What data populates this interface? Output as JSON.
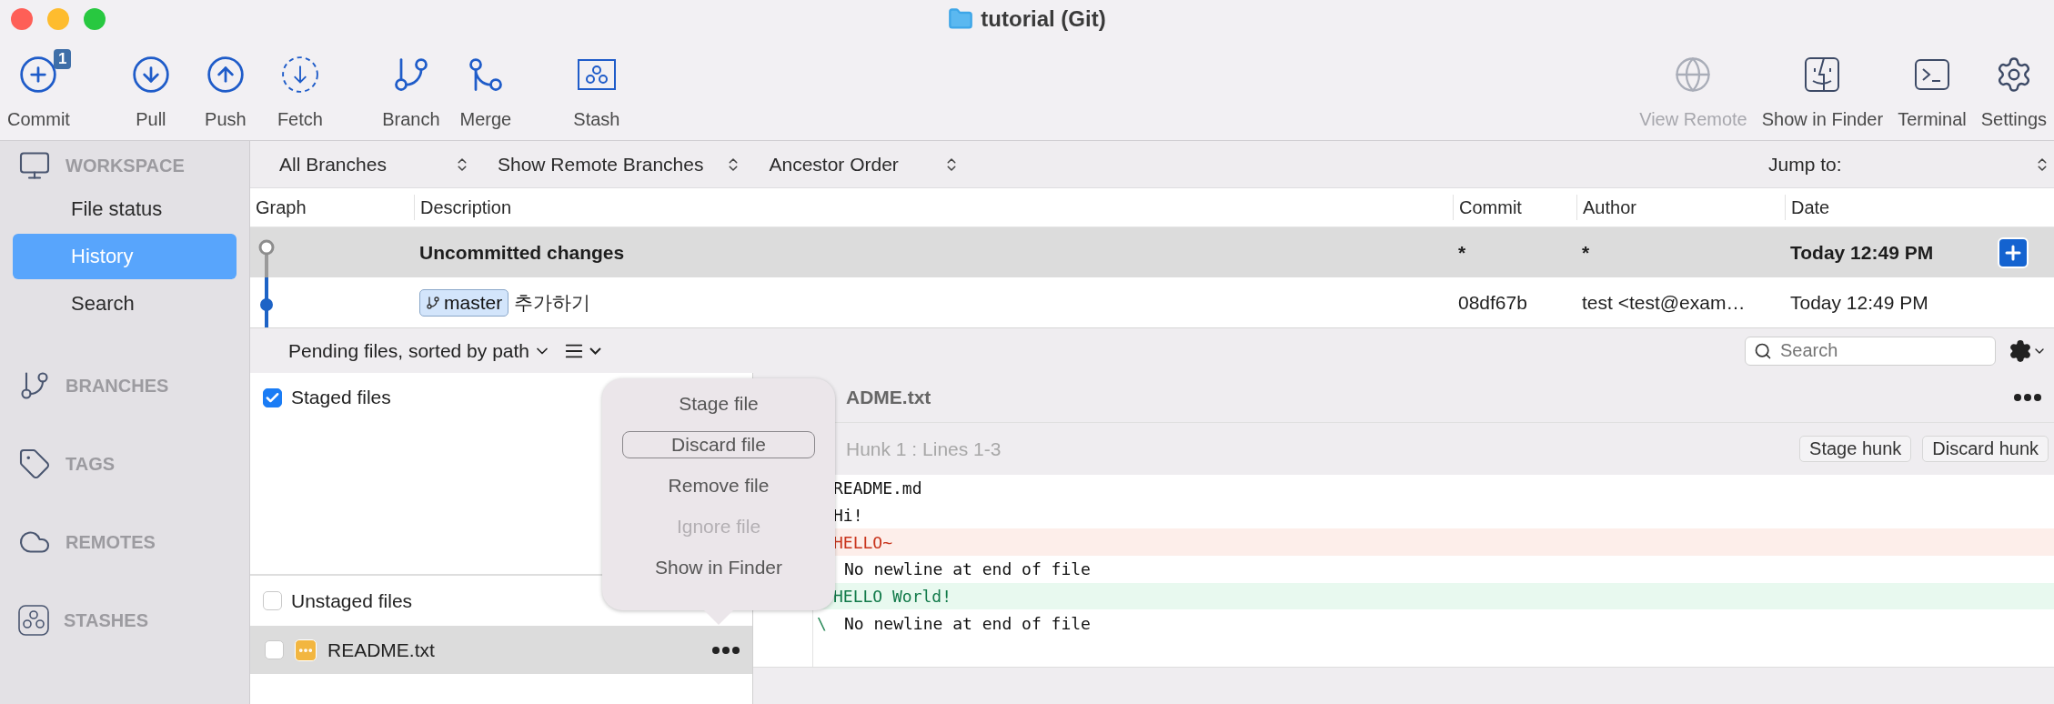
{
  "window": {
    "title": "tutorial (Git)"
  },
  "toolbar": {
    "left_groups": [
      {
        "items": [
          {
            "kind": "commit",
            "label": "Commit",
            "badge": "1",
            "disabled": false
          }
        ]
      },
      {
        "items": [
          {
            "kind": "pull",
            "label": "Pull",
            "disabled": false
          },
          {
            "kind": "push",
            "label": "Push",
            "disabled": false
          },
          {
            "kind": "fetch",
            "label": "Fetch",
            "disabled": false
          }
        ]
      },
      {
        "items": [
          {
            "kind": "branch",
            "label": "Branch",
            "disabled": false
          },
          {
            "kind": "merge",
            "label": "Merge",
            "disabled": false
          }
        ]
      },
      {
        "items": [
          {
            "kind": "stash",
            "label": "Stash",
            "disabled": false
          }
        ]
      }
    ],
    "right_items": [
      {
        "kind": "remote",
        "label": "View Remote",
        "disabled": true
      },
      {
        "kind": "finder",
        "label": "Show in Finder",
        "disabled": false
      },
      {
        "kind": "terminal",
        "label": "Terminal",
        "disabled": false
      },
      {
        "kind": "settings",
        "label": "Settings",
        "disabled": false
      }
    ]
  },
  "sidebar": {
    "sections": [
      {
        "kind": "workspace",
        "title": "WORKSPACE",
        "items": [
          {
            "label": "File status",
            "selected": false
          },
          {
            "label": "History",
            "selected": true
          },
          {
            "label": "Search",
            "selected": false
          }
        ]
      },
      {
        "kind": "branches",
        "title": "BRANCHES"
      },
      {
        "kind": "tags",
        "title": "TAGS"
      },
      {
        "kind": "remotes",
        "title": "REMOTES"
      },
      {
        "kind": "stashes",
        "title": "STASHES"
      }
    ]
  },
  "filters": {
    "dropdowns": [
      "All Branches",
      "Show Remote Branches",
      "Ancestor Order"
    ],
    "jump_to": "Jump to:"
  },
  "history": {
    "columns": [
      "Graph",
      "Description",
      "Commit",
      "Author",
      "Date"
    ],
    "rows": [
      {
        "kind": "uncommitted",
        "description": "Uncommitted changes",
        "commit": "*",
        "author": "*",
        "date": "Today 12:49 PM",
        "selected": true
      },
      {
        "kind": "commit",
        "branch": "master",
        "description": "추가하기",
        "commit": "08df67b",
        "author": "test <test@exam…",
        "date": "Today 12:49 PM",
        "selected": false
      }
    ]
  },
  "pending": {
    "sort": "Pending files, sorted by path",
    "search": {
      "placeholder": "Search"
    }
  },
  "staged": {
    "title": "Staged files",
    "checked": true
  },
  "unstaged": {
    "title": "Unstaged files",
    "checked": false,
    "files": [
      {
        "name": "README.txt",
        "checked": false,
        "selected": true
      }
    ]
  },
  "file_menu": {
    "items": [
      {
        "label": "Stage file",
        "disabled": false,
        "focused": false
      },
      {
        "label": "Discard file",
        "disabled": false,
        "focused": true
      },
      {
        "label": "Remove file",
        "disabled": false,
        "focused": false
      },
      {
        "label": "Ignore file",
        "disabled": true,
        "focused": false
      },
      {
        "label": "Show in Finder",
        "disabled": false,
        "focused": false
      }
    ]
  },
  "diff": {
    "file": "ADME.txt",
    "hunk": {
      "title": "Hunk 1 : Lines 1-3",
      "buttons": [
        "Stage hunk",
        "Discard hunk"
      ]
    },
    "lines": [
      {
        "kind": "context",
        "text": "README.md"
      },
      {
        "kind": "context",
        "text": "Hi!"
      },
      {
        "kind": "removed",
        "text": "HELLO~"
      },
      {
        "kind": "note",
        "text": "No newline at end of file"
      },
      {
        "kind": "added",
        "text": "HELLO World!"
      },
      {
        "kind": "note",
        "prefix": "\\",
        "text": "No newline at end of file"
      }
    ]
  }
}
